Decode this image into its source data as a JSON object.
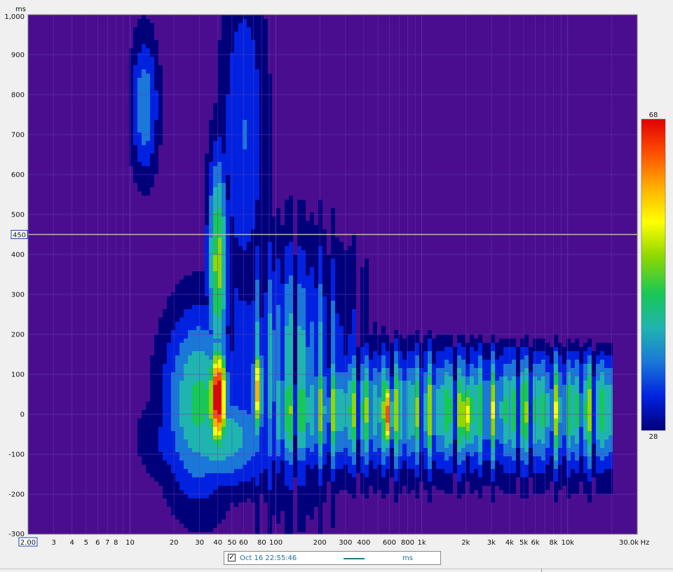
{
  "chart_data": {
    "type": "heatmap",
    "title": "",
    "xlabel": "",
    "ylabel": "",
    "y_unit": "ms",
    "x_unit": "Hz",
    "x_scale": "log",
    "xlim": [
      2,
      30000
    ],
    "ylim": [
      -300,
      1000
    ],
    "x_min_box": "2.00",
    "x_max_label": "30.0k",
    "x_ticks": [
      {
        "v": 3,
        "t": "3"
      },
      {
        "v": 4,
        "t": "4"
      },
      {
        "v": 5,
        "t": "5"
      },
      {
        "v": 6,
        "t": "6"
      },
      {
        "v": 7,
        "t": "7"
      },
      {
        "v": 8,
        "t": "8"
      },
      {
        "v": 10,
        "t": "10"
      },
      {
        "v": 20,
        "t": "20"
      },
      {
        "v": 30,
        "t": "30"
      },
      {
        "v": 40,
        "t": "40"
      },
      {
        "v": 50,
        "t": "50"
      },
      {
        "v": 60,
        "t": "60"
      },
      {
        "v": 80,
        "t": "80"
      },
      {
        "v": 100,
        "t": "100"
      },
      {
        "v": 200,
        "t": "200"
      },
      {
        "v": 300,
        "t": "300"
      },
      {
        "v": 400,
        "t": "400"
      },
      {
        "v": 600,
        "t": "600"
      },
      {
        "v": 800,
        "t": "800"
      },
      {
        "v": 1000,
        "t": "1k"
      },
      {
        "v": 2000,
        "t": "2k"
      },
      {
        "v": 3000,
        "t": "3k"
      },
      {
        "v": 4000,
        "t": "4k"
      },
      {
        "v": 5000,
        "t": "5k"
      },
      {
        "v": 6000,
        "t": "6k"
      },
      {
        "v": 8000,
        "t": "8k"
      },
      {
        "v": 10000,
        "t": "10k"
      }
    ],
    "y_ticks": [
      {
        "v": 1000,
        "t": "1,000"
      },
      {
        "v": 900,
        "t": "900"
      },
      {
        "v": 800,
        "t": "800"
      },
      {
        "v": 700,
        "t": "700"
      },
      {
        "v": 600,
        "t": "600"
      },
      {
        "v": 500,
        "t": "500"
      },
      {
        "v": 400,
        "t": "400"
      },
      {
        "v": 300,
        "t": "300"
      },
      {
        "v": 200,
        "t": "200"
      },
      {
        "v": 100,
        "t": "100"
      },
      {
        "v": 0,
        "t": "0"
      },
      {
        "v": -100,
        "t": "-100"
      },
      {
        "v": -200,
        "t": "-200"
      },
      {
        "v": -300,
        "t": "-300"
      }
    ],
    "cursor": {
      "y": 450,
      "label": "450"
    },
    "colorbar": {
      "max": 68,
      "min": 28,
      "max_label": "68",
      "min_label": "28"
    },
    "colors": {
      "background": "#4a0d8f",
      "grid": "#6a3ab8",
      "cursor_line": "#b8b8b8",
      "axis_box_border": "#1a3fbf",
      "scale": [
        "#00007a",
        "#0022e0",
        "#1a78d8",
        "#1fb4b0",
        "#18c855",
        "#8fd800",
        "#ffff00",
        "#ffb000",
        "#ff5000",
        "#e00000"
      ]
    },
    "content_start_hz": 10,
    "content_end_hz": 20000,
    "features": [
      {
        "name": "low-frequency decay",
        "hz": 12,
        "ms": 770,
        "level": 0.45
      },
      {
        "name": "mode",
        "hz": 40,
        "ms": 40,
        "level": 1.0
      },
      {
        "name": "mode",
        "hz": 580,
        "ms": 0,
        "level": 0.9
      },
      {
        "name": "mode",
        "hz": 2000,
        "ms": 0,
        "level": 0.85
      }
    ],
    "legend": {
      "label": "Oct 16 22:55:46",
      "unit": "ms",
      "checked": true,
      "line_color": "#1f7a86"
    }
  }
}
